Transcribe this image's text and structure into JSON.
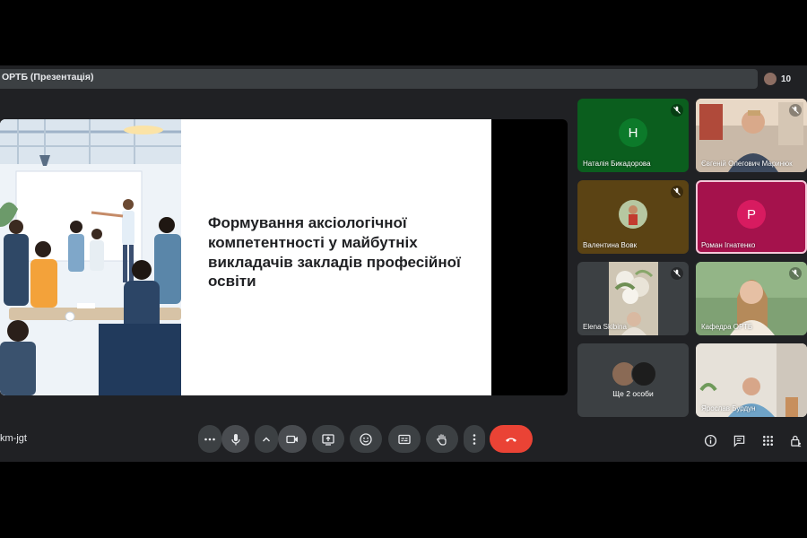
{
  "window": {
    "title": "ОРТБ (Презентація)",
    "participant_count": "10"
  },
  "slide": {
    "title": "Формування аксіологічної компетентності у майбутніх викладачів закладів професійної освіти"
  },
  "participants": [
    {
      "name": "Наталія Бикадорова",
      "initial": "Н",
      "tile_color": "#0b5e1e",
      "avatar_color": "#0c7a2a",
      "muted": true
    },
    {
      "name": "Євгеній Олегович Маринюк",
      "video": true,
      "muted": true
    },
    {
      "name": "Валентина Вовк",
      "tile_color": "#5b4314",
      "photo_avatar": true,
      "muted": true
    },
    {
      "name": "Роман Ігнатенко",
      "initial": "Р",
      "tile_color": "#a5124c",
      "avatar_color": "#d81b60",
      "muted": false
    },
    {
      "name": "Elena Skibina",
      "video": true,
      "muted": true
    },
    {
      "name": "Кафедра ОРТБ",
      "video": true,
      "muted": true
    },
    {
      "more_label": "Ще 2 особи"
    },
    {
      "name": "Ярослав Бурдун",
      "video": true
    }
  ],
  "controls": {
    "meeting_code": "km-jgt",
    "buttons": [
      "more-options",
      "microphone",
      "camera-options",
      "camera",
      "present-screen",
      "reactions",
      "captions",
      "raise-hand",
      "more-actions",
      "leave-call"
    ],
    "right": [
      "meeting-info",
      "chat",
      "activities",
      "host-controls"
    ],
    "leave_color": "#ea4335"
  }
}
